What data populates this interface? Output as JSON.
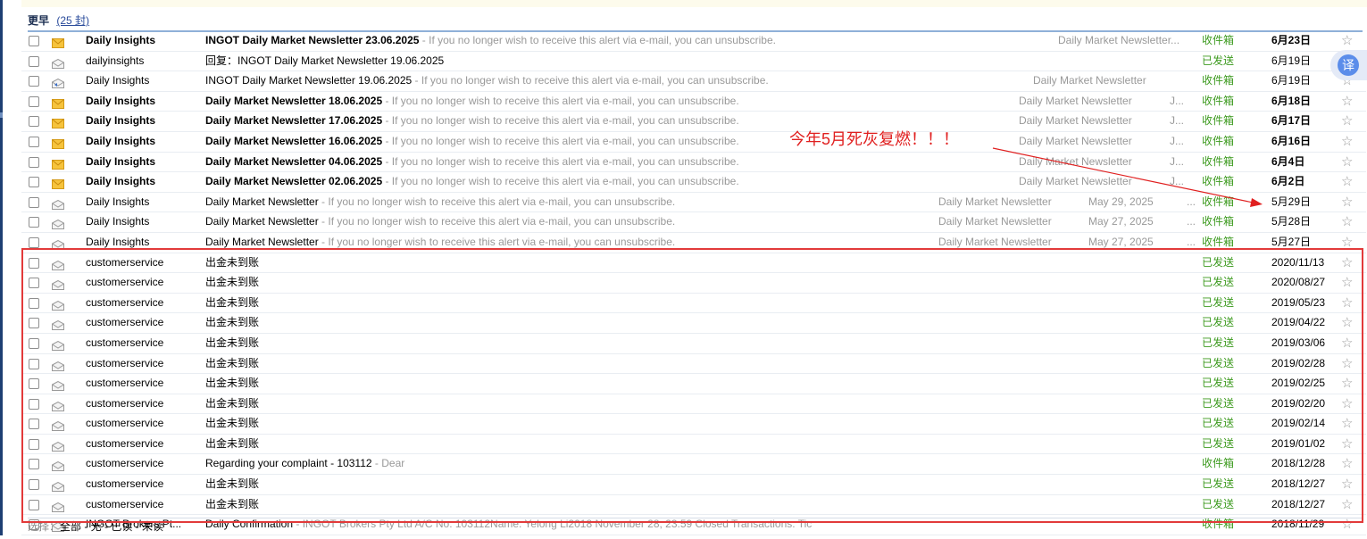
{
  "group": {
    "title": "更早",
    "count": "(25 封)"
  },
  "rows": [
    {
      "unread": true,
      "icon": "envelope-closed",
      "sender": "Daily Insights",
      "subject": "INGOT Daily Market Newsletter 23.06.2025",
      "preview": " - If you no longer wish to receive this alert via e-mail, you can unsubscribe.",
      "from2": "Daily Market Newsletter...",
      "date2": "",
      "folder": "收件箱",
      "date": "6月23日"
    },
    {
      "unread": false,
      "icon": "envelope-open",
      "sender": "dailyinsights",
      "subject": "回复：INGOT Daily Market Newsletter 19.06.2025",
      "preview": "",
      "from2": "",
      "date2": "",
      "folder": "已发送",
      "date": "6月19日"
    },
    {
      "unread": false,
      "icon": "envelope-replied",
      "sender": "Daily Insights",
      "subject": "INGOT Daily Market Newsletter 19.06.2025",
      "preview": " - If you no longer wish to receive this alert via e-mail, you can unsubscribe.",
      "from2": "Daily Market Newsletter",
      "date2": "",
      "folder": "收件箱",
      "date": "6月19日"
    },
    {
      "unread": true,
      "icon": "envelope-closed",
      "sender": "Daily Insights",
      "subject": "Daily Market Newsletter 18.06.2025",
      "preview": " - If you no longer wish to receive this alert via e-mail, you can unsubscribe.",
      "from2": "Daily Market Newsletter",
      "date2": "",
      "dots": "J...",
      "folder": "收件箱",
      "date": "6月18日"
    },
    {
      "unread": true,
      "icon": "envelope-closed",
      "sender": "Daily Insights",
      "subject": "Daily Market Newsletter 17.06.2025",
      "preview": " - If you no longer wish to receive this alert via e-mail, you can unsubscribe.",
      "from2": "Daily Market Newsletter",
      "date2": "",
      "dots": "J...",
      "folder": "收件箱",
      "date": "6月17日"
    },
    {
      "unread": true,
      "icon": "envelope-closed",
      "sender": "Daily Insights",
      "subject": "Daily Market Newsletter 16.06.2025",
      "preview": " - If you no longer wish to receive this alert via e-mail, you can unsubscribe.",
      "from2": "Daily Market Newsletter",
      "date2": "",
      "dots": "J...",
      "folder": "收件箱",
      "date": "6月16日"
    },
    {
      "unread": true,
      "icon": "envelope-closed",
      "sender": "Daily Insights",
      "subject": "Daily Market Newsletter 04.06.2025",
      "preview": " - If you no longer wish to receive this alert via e-mail, you can unsubscribe.",
      "from2": "Daily Market Newsletter",
      "date2": "",
      "dots": "J...",
      "folder": "收件箱",
      "date": "6月4日"
    },
    {
      "unread": true,
      "icon": "envelope-closed",
      "sender": "Daily Insights",
      "subject": "Daily Market Newsletter 02.06.2025",
      "preview": " - If you no longer wish to receive this alert via e-mail, you can unsubscribe.",
      "from2": "Daily Market Newsletter",
      "date2": "",
      "dots": "J...",
      "folder": "收件箱",
      "date": "6月2日"
    },
    {
      "unread": false,
      "icon": "envelope-open",
      "sender": "Daily Insights",
      "subject": "Daily Market Newsletter",
      "preview": " - If you no longer wish to receive this alert via e-mail, you can unsubscribe.",
      "from2": "Daily Market Newsletter",
      "date2": "May 29, 2025",
      "dots": "...",
      "folder": "收件箱",
      "date": "5月29日"
    },
    {
      "unread": false,
      "icon": "envelope-open",
      "sender": "Daily Insights",
      "subject": "Daily Market Newsletter",
      "preview": " - If you no longer wish to receive this alert via e-mail, you can unsubscribe.",
      "from2": "Daily Market Newsletter",
      "date2": "May 27, 2025",
      "dots": "...",
      "folder": "收件箱",
      "date": "5月28日"
    },
    {
      "unread": false,
      "icon": "envelope-open",
      "sender": "Daily Insights",
      "subject": "Daily Market Newsletter",
      "preview": " - If you no longer wish to receive this alert via e-mail, you can unsubscribe.",
      "from2": "Daily Market Newsletter",
      "date2": "May 27, 2025",
      "dots": "...",
      "folder": "收件箱",
      "date": "5月27日"
    },
    {
      "unread": false,
      "icon": "envelope-open",
      "sender": "customerservice",
      "subject": "出金未到账",
      "preview": "",
      "from2": "",
      "date2": "",
      "folder": "已发送",
      "date": "2020/11/13"
    },
    {
      "unread": false,
      "icon": "envelope-open",
      "sender": "customerservice",
      "subject": "出金未到账",
      "preview": "",
      "from2": "",
      "date2": "",
      "folder": "已发送",
      "date": "2020/08/27"
    },
    {
      "unread": false,
      "icon": "envelope-open",
      "sender": "customerservice",
      "subject": "出金未到账",
      "preview": "",
      "from2": "",
      "date2": "",
      "folder": "已发送",
      "date": "2019/05/23"
    },
    {
      "unread": false,
      "icon": "envelope-open",
      "sender": "customerservice",
      "subject": "出金未到账",
      "preview": "",
      "from2": "",
      "date2": "",
      "folder": "已发送",
      "date": "2019/04/22"
    },
    {
      "unread": false,
      "icon": "envelope-open",
      "sender": "customerservice",
      "subject": "出金未到账",
      "preview": "",
      "from2": "",
      "date2": "",
      "folder": "已发送",
      "date": "2019/03/06"
    },
    {
      "unread": false,
      "icon": "envelope-open",
      "sender": "customerservice",
      "subject": "出金未到账",
      "preview": "",
      "from2": "",
      "date2": "",
      "folder": "已发送",
      "date": "2019/02/28"
    },
    {
      "unread": false,
      "icon": "envelope-open",
      "sender": "customerservice",
      "subject": "出金未到账",
      "preview": "",
      "from2": "",
      "date2": "",
      "folder": "已发送",
      "date": "2019/02/25"
    },
    {
      "unread": false,
      "icon": "envelope-open",
      "sender": "customerservice",
      "subject": "出金未到账",
      "preview": "",
      "from2": "",
      "date2": "",
      "folder": "已发送",
      "date": "2019/02/20"
    },
    {
      "unread": false,
      "icon": "envelope-open",
      "sender": "customerservice",
      "subject": "出金未到账",
      "preview": "",
      "from2": "",
      "date2": "",
      "folder": "已发送",
      "date": "2019/02/14"
    },
    {
      "unread": false,
      "icon": "envelope-open",
      "sender": "customerservice",
      "subject": "出金未到账",
      "preview": "",
      "from2": "",
      "date2": "",
      "folder": "已发送",
      "date": "2019/01/02"
    },
    {
      "unread": false,
      "icon": "envelope-open",
      "sender": "customerservice",
      "subject": "Regarding your complaint - 103112",
      "preview": " -  Dear",
      "from2": "",
      "date2": "",
      "folder": "收件箱",
      "date": "2018/12/28"
    },
    {
      "unread": false,
      "icon": "envelope-open",
      "sender": "customerservice",
      "subject": "出金未到账",
      "preview": "",
      "from2": "",
      "date2": "",
      "folder": "已发送",
      "date": "2018/12/27"
    },
    {
      "unread": false,
      "icon": "envelope-open",
      "sender": "customerservice",
      "subject": "出金未到账",
      "preview": "",
      "from2": "",
      "date2": "",
      "folder": "已发送",
      "date": "2018/12/27"
    },
    {
      "unread": false,
      "icon": "envelope-open",
      "sender": "INGOT Brokers Pt...",
      "subject": "Daily Confirmation",
      "preview": " - INGOT Brokers Pty Ltd A/C No: 103112Name: Yelong Li2018 November 28, 23:59 Closed Transactions: Tic",
      "from2": "",
      "date2": "",
      "folder": "收件箱",
      "date": "2018/11/29"
    }
  ],
  "bottom": {
    "prefix": "选择：",
    "options": "全部 - 无 - 已读 - 未读"
  },
  "annotation": "今年5月死灰复燃！！！",
  "translate_label": "译",
  "colors": {
    "accent": "#2a4b9b",
    "folder_green": "#3c9a1e",
    "annotation_red": "#e02020"
  }
}
